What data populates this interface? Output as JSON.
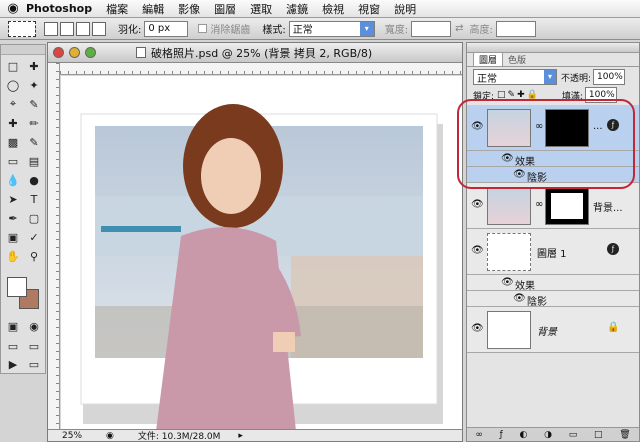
{
  "menubar": {
    "app_name": "Photoshop",
    "items": [
      "檔案",
      "編輯",
      "影像",
      "圖層",
      "選取",
      "濾鏡",
      "檢視",
      "視窗",
      "說明"
    ]
  },
  "options": {
    "feather_label": "羽化:",
    "feather_value": "0 px",
    "antialias_label": "消除鋸齒",
    "style_label": "樣式:",
    "style_value": "正常",
    "width_label": "寬度:",
    "height_label": "高度:"
  },
  "document": {
    "title": "破格照片.psd @ 25% (背景 拷貝 2, RGB/8)",
    "zoom": "25%",
    "file_info": "文件: 10.3M/28.0M"
  },
  "layers_panel": {
    "tab_layers": "圖層",
    "tab_channels": "色版",
    "blend_mode": "正常",
    "opacity_label": "不透明:",
    "opacity_value": "100%",
    "lock_label": "鎖定:",
    "fill_label": "填滿:",
    "fill_value": "100%",
    "layers": [
      {
        "name": "...",
        "selected": true,
        "effects_label": "效果",
        "effect": "陰影"
      },
      {
        "name": "背景..."
      },
      {
        "name": "圖層 1",
        "effects_label": "效果",
        "effect": "陰影"
      },
      {
        "name": "背景"
      }
    ]
  }
}
